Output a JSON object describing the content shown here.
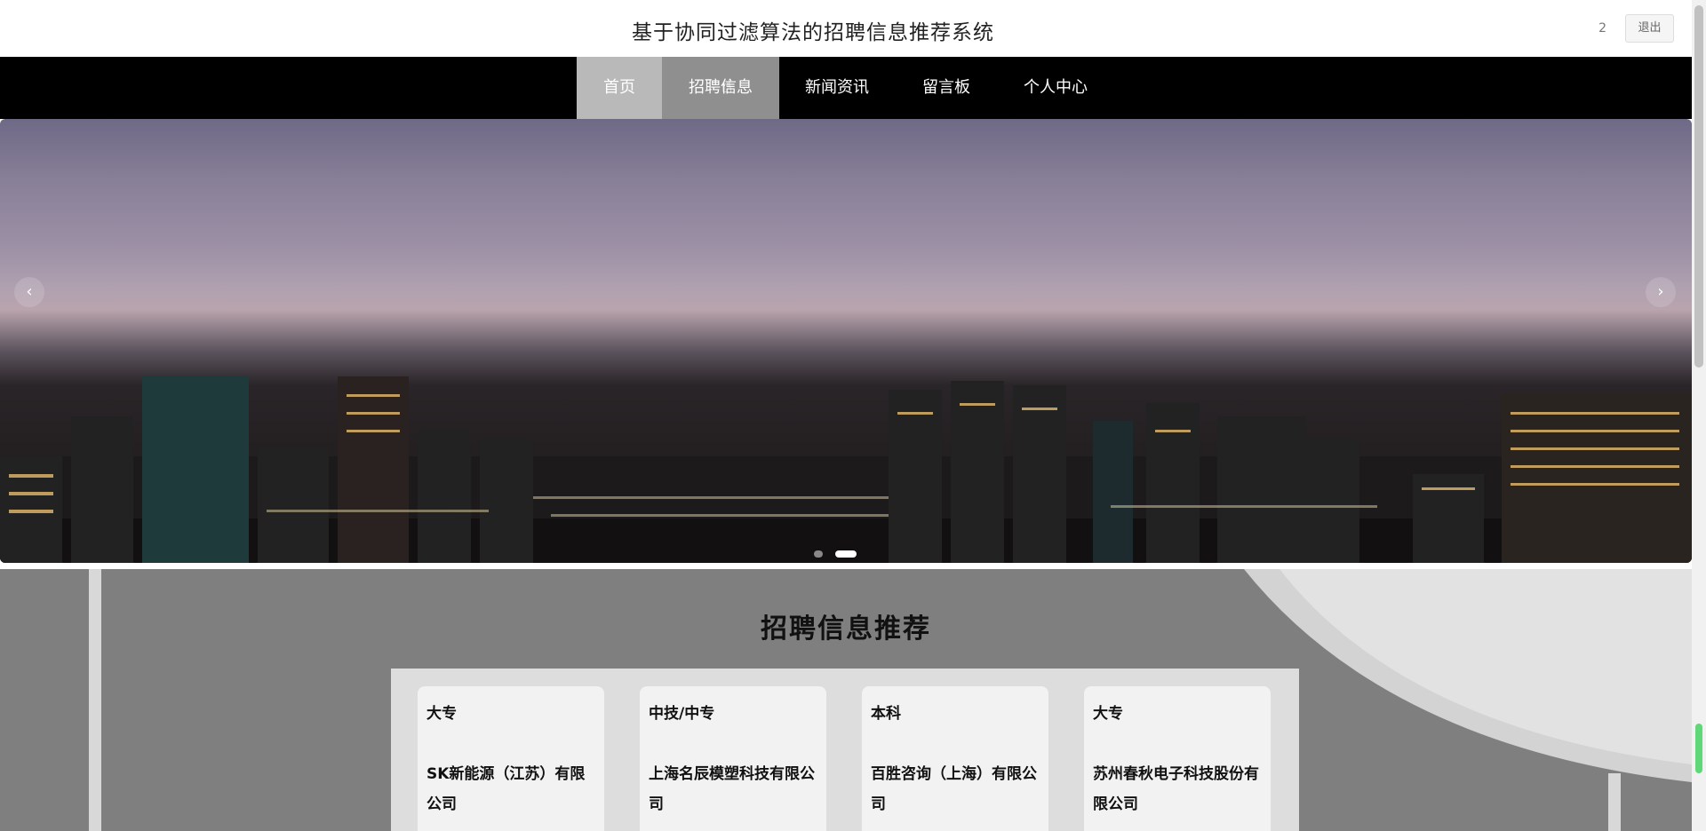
{
  "header": {
    "title": "基于协同过滤算法的招聘信息推荐系统",
    "user_label": "2",
    "logout_label": "退出"
  },
  "nav": {
    "items": [
      {
        "label": "首页",
        "state": "active"
      },
      {
        "label": "招聘信息",
        "state": "hover"
      },
      {
        "label": "新闻资讯",
        "state": "normal"
      },
      {
        "label": "留言板",
        "state": "normal"
      },
      {
        "label": "个人中心",
        "state": "normal"
      }
    ]
  },
  "carousel": {
    "prev_icon": "‹",
    "next_icon": "›",
    "slide_count": 3,
    "active_slide": 2
  },
  "recommend": {
    "title": "招聘信息推荐",
    "cards": [
      {
        "education": "大专",
        "company": "SK新能源（江苏）有限公司"
      },
      {
        "education": "中技/中专",
        "company": "上海名辰模塑科技有限公司"
      },
      {
        "education": "本科",
        "company": "百胜咨询（上海）有限公司"
      },
      {
        "education": "大专",
        "company": "苏州春秋电子科技股份有限公司"
      }
    ]
  },
  "colors": {
    "navbar": "#000000",
    "nav_active": "#b9b9b9",
    "nav_hover": "#8f8f8f",
    "section_bg": "#7f7f7f",
    "panel_bg": "#dddddd",
    "card_bg": "#f2f2f2"
  }
}
